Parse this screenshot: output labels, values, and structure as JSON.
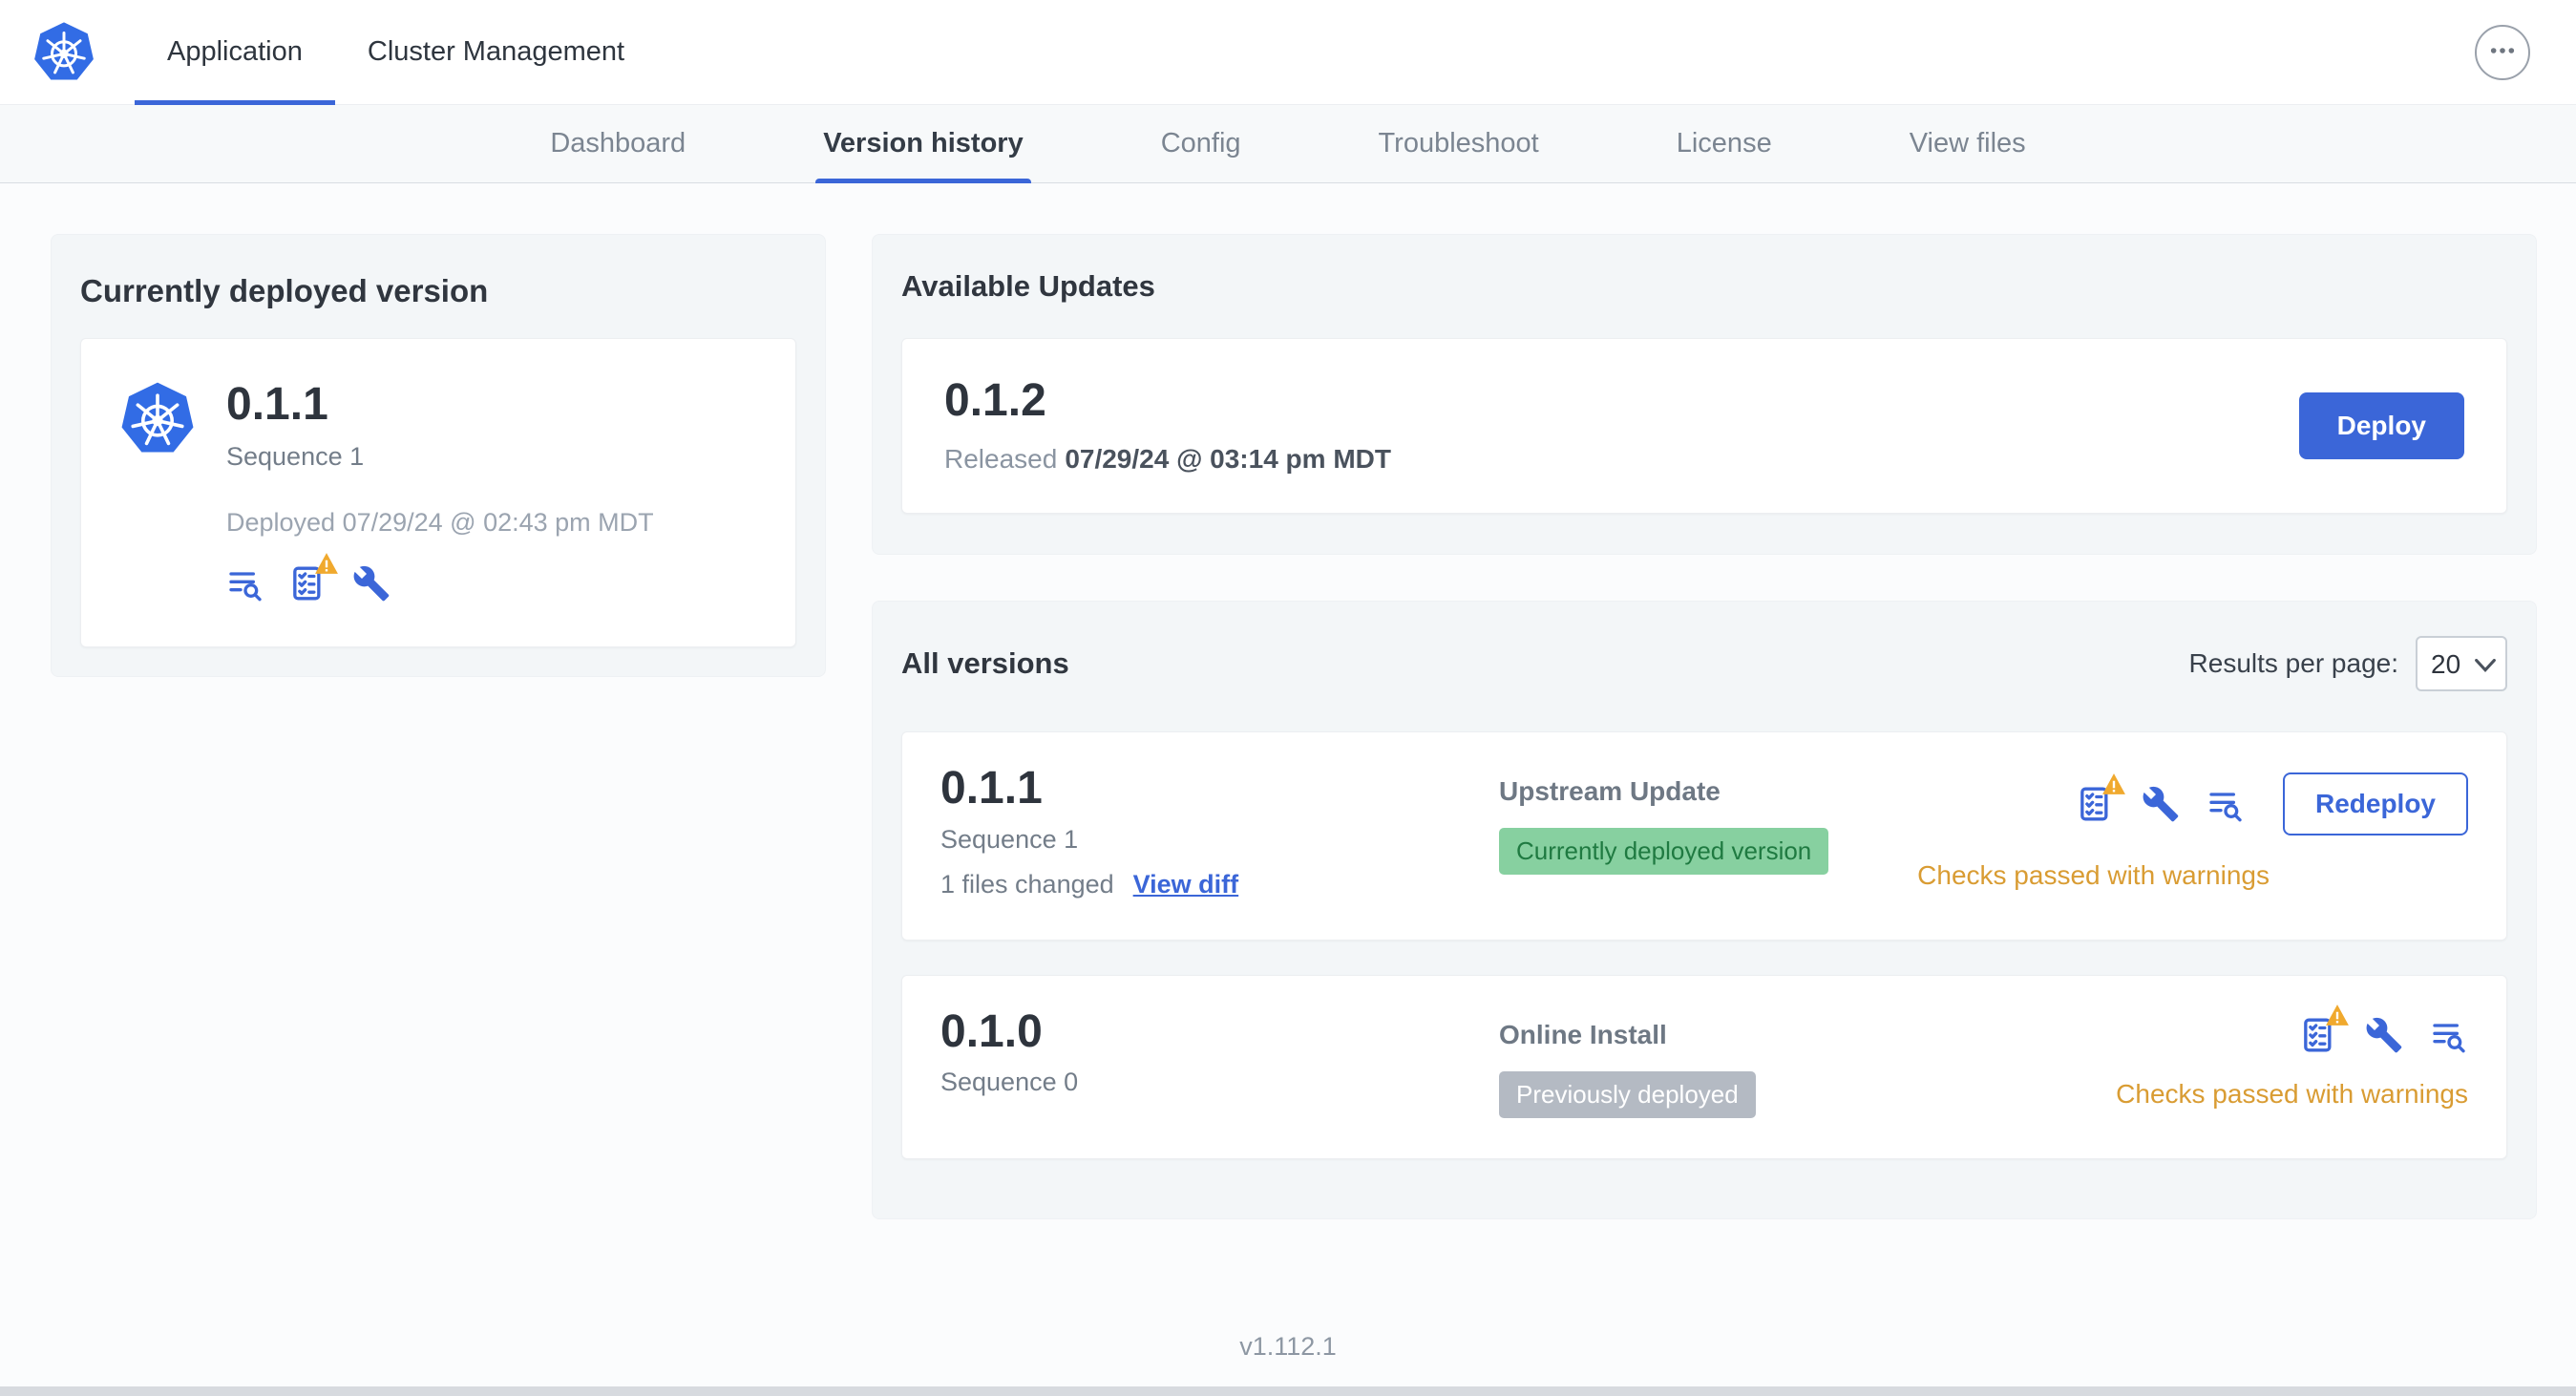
{
  "topnav": {
    "tabs": [
      {
        "label": "Application",
        "active": true
      },
      {
        "label": "Cluster Management",
        "active": false
      }
    ]
  },
  "subnav": {
    "tabs": [
      "Dashboard",
      "Version history",
      "Config",
      "Troubleshoot",
      "License",
      "View files"
    ],
    "active": "Version history"
  },
  "current_version": {
    "title": "Currently deployed version",
    "version": "0.1.1",
    "sequence": "Sequence 1",
    "deployed": "Deployed 07/29/24 @ 02:43 pm MDT"
  },
  "available_updates": {
    "title": "Available Updates",
    "version": "0.1.2",
    "released_prefix": "Released",
    "released_date": "07/29/24 @ 03:14 pm MDT",
    "deploy_label": "Deploy"
  },
  "all_versions": {
    "title": "All versions",
    "results_per_page_label": "Results per page:",
    "results_per_page_value": "20",
    "rows": [
      {
        "version": "0.1.1",
        "sequence": "Sequence 1",
        "files_changed": "1 files changed",
        "view_diff_label": "View diff",
        "source": "Upstream Update",
        "badge": "Currently deployed version",
        "badge_type": "green",
        "status": "Checks passed with warnings",
        "action_label": "Redeploy"
      },
      {
        "version": "0.1.0",
        "sequence": "Sequence 0",
        "source": "Online Install",
        "badge": "Previously deployed",
        "badge_type": "gray",
        "status": "Checks passed with warnings"
      }
    ]
  },
  "footer": {
    "version": "v1.112.1"
  },
  "icons": {
    "app_logo": "kubernetes-helm-wheel",
    "release_notes": "text-lines-with-magnifier",
    "preflight_checks": "checklist-with-warning-triangle",
    "config": "wrench",
    "more_menu": "ellipsis-in-circle",
    "select_chevron": "chevron-down"
  },
  "colors": {
    "accent_blue": "#3b66d8",
    "k8s_blue": "#326ce5",
    "warning_orange": "#d99c33",
    "warning_triangle": "#f0a92e",
    "badge_green_bg": "#87d0a0",
    "badge_green_text": "#1f7a41",
    "badge_gray_bg": "#b4bac3"
  }
}
